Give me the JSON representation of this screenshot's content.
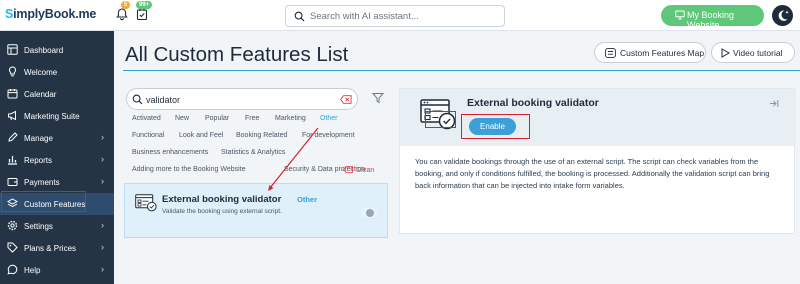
{
  "topbar": {
    "logo_prefix": "S",
    "logo_rest": "implyBook.me",
    "notif_badge": "5",
    "tasks_badge": "99+",
    "search_placeholder": "Search with AI assistant...",
    "my_booking_label": "My Booking Website"
  },
  "sidebar": {
    "items": [
      {
        "label": "Dashboard",
        "icon": "dashboard-icon",
        "chevron": false
      },
      {
        "label": "Welcome",
        "icon": "bulb-icon",
        "chevron": false
      },
      {
        "label": "Calendar",
        "icon": "calendar-icon",
        "chevron": false
      },
      {
        "label": "Marketing Suite",
        "icon": "megaphone-icon",
        "chevron": false
      },
      {
        "label": "Manage",
        "icon": "pencil-icon",
        "chevron": true
      },
      {
        "label": "Reports",
        "icon": "chart-icon",
        "chevron": true
      },
      {
        "label": "Payments",
        "icon": "wallet-icon",
        "chevron": true
      },
      {
        "label": "Custom Features",
        "icon": "layers-icon",
        "chevron": false,
        "active": true
      },
      {
        "label": "Settings",
        "icon": "gear-icon",
        "chevron": true
      },
      {
        "label": "Plans & Prices",
        "icon": "tag-icon",
        "chevron": true
      },
      {
        "label": "Help",
        "icon": "chat-icon",
        "chevron": true
      }
    ]
  },
  "main": {
    "title": "All Custom Features List",
    "map_button": "Custom Features Map",
    "video_button": "Video tutorial",
    "search_value": "validator",
    "tags": [
      "Activated",
      "New",
      "Popular",
      "Free",
      "Marketing",
      "Other",
      "Functional",
      "Look and Feel",
      "Booking Related",
      "For development",
      "Business enhancements",
      "Statistics & Analytics",
      "Adding more to the Booking Website",
      "Security & Data protection"
    ],
    "clean_label": "Clean",
    "card": {
      "title": "External booking validator",
      "badge": "Other",
      "desc": "Validate the booking using external script."
    },
    "detail": {
      "title": "External booking validator",
      "enable_label": "Enable",
      "body": "You can validate bookings through the use of an external script. The script can check variables from the booking, and only if conditions fulfilled, the booking is processed. Additionally the validation script can bring back information that can be injected into intake form variables."
    }
  },
  "colors": {
    "sidebar_bg": "#243445",
    "accent": "#2fa3d6",
    "green": "#5fc77a",
    "highlight": "#d6222f"
  }
}
